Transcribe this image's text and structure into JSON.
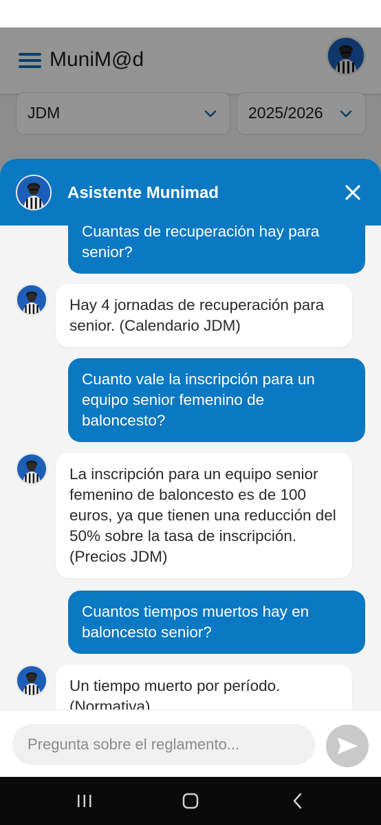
{
  "app": {
    "title": "MuniM@d",
    "filters": {
      "competition": "JDM",
      "season": "2025/2026"
    }
  },
  "chat": {
    "title": "Asistente Munimad",
    "messages": [
      {
        "role": "user",
        "text": "Cuantas de recuperación hay para senior?"
      },
      {
        "role": "bot",
        "text": "Hay 4 jornadas de recuperación para senior. (Calendario JDM)"
      },
      {
        "role": "user",
        "text": "Cuanto vale la inscripción para un equipo senior femenino de baloncesto?"
      },
      {
        "role": "bot",
        "text": "La inscripción para un equipo senior femenino de baloncesto es de 100 euros, ya que tienen una reducción del 50% sobre la tasa de inscripción. (Precios JDM)"
      },
      {
        "role": "user",
        "text": "Cuantos tiempos muertos hay en baloncesto senior?"
      },
      {
        "role": "bot",
        "text": "Un tiempo muerto por período. (Normativa)"
      }
    ],
    "input": {
      "placeholder": "Pregunta sobre el reglamento...",
      "value": ""
    }
  },
  "icons": {
    "menu": "hamburger-menu-icon",
    "avatar": "referee-avatar",
    "close": "close-icon",
    "send": "send-icon",
    "nav_recents": "recents-icon",
    "nav_home": "home-icon",
    "nav_back": "back-icon"
  },
  "colors": {
    "primary": "#0a78c2",
    "bubble_bot": "#ffffff",
    "send_disabled": "#c9c9c9"
  }
}
